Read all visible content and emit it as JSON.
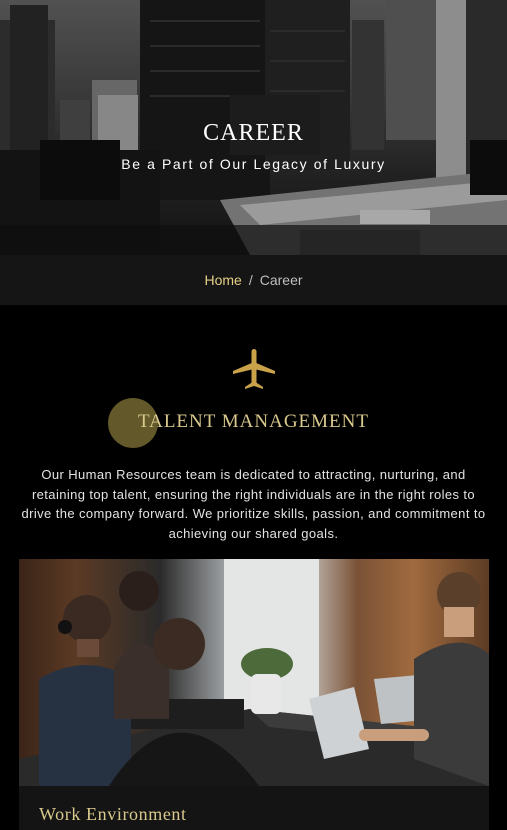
{
  "hero": {
    "title": "CAREER",
    "subtitle": "Be a Part of Our Legacy of Luxury"
  },
  "breadcrumb": {
    "home": "Home",
    "separator": "/",
    "current": "Career"
  },
  "talent": {
    "icon": "airplane-icon",
    "title": "TALENT MANAGEMENT",
    "description": "Our Human Resources team is dedicated to attracting, nurturing, and retaining top talent, ensuring the right individuals are in the right roles to drive the company forward. We prioritize skills, passion, and commitment to achieving our shared goals."
  },
  "card": {
    "caption": "Work Environment"
  },
  "colors": {
    "accent_gold": "#d9c98e",
    "breadcrumb_home": "#e6cf85",
    "background": "#000000",
    "breadcrumb_bar": "#151515"
  }
}
